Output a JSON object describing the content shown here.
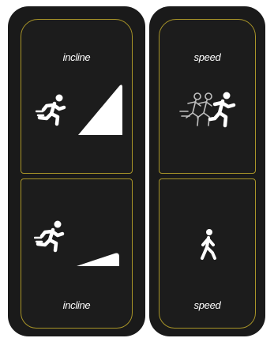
{
  "keys": {
    "incline_up": {
      "label": "incline",
      "icons": [
        "runner-icon",
        "steep-incline-icon"
      ]
    },
    "incline_down": {
      "label": "incline",
      "icons": [
        "runner-icon",
        "shallow-incline-icon"
      ]
    },
    "speed_up": {
      "label": "speed",
      "icons": [
        "fast-runners-icon"
      ]
    },
    "speed_down": {
      "label": "speed",
      "icons": [
        "walker-icon"
      ]
    }
  },
  "colors": {
    "panel": "#1a1a1a",
    "key_border": "#a99528",
    "icon": "#ffffff"
  }
}
